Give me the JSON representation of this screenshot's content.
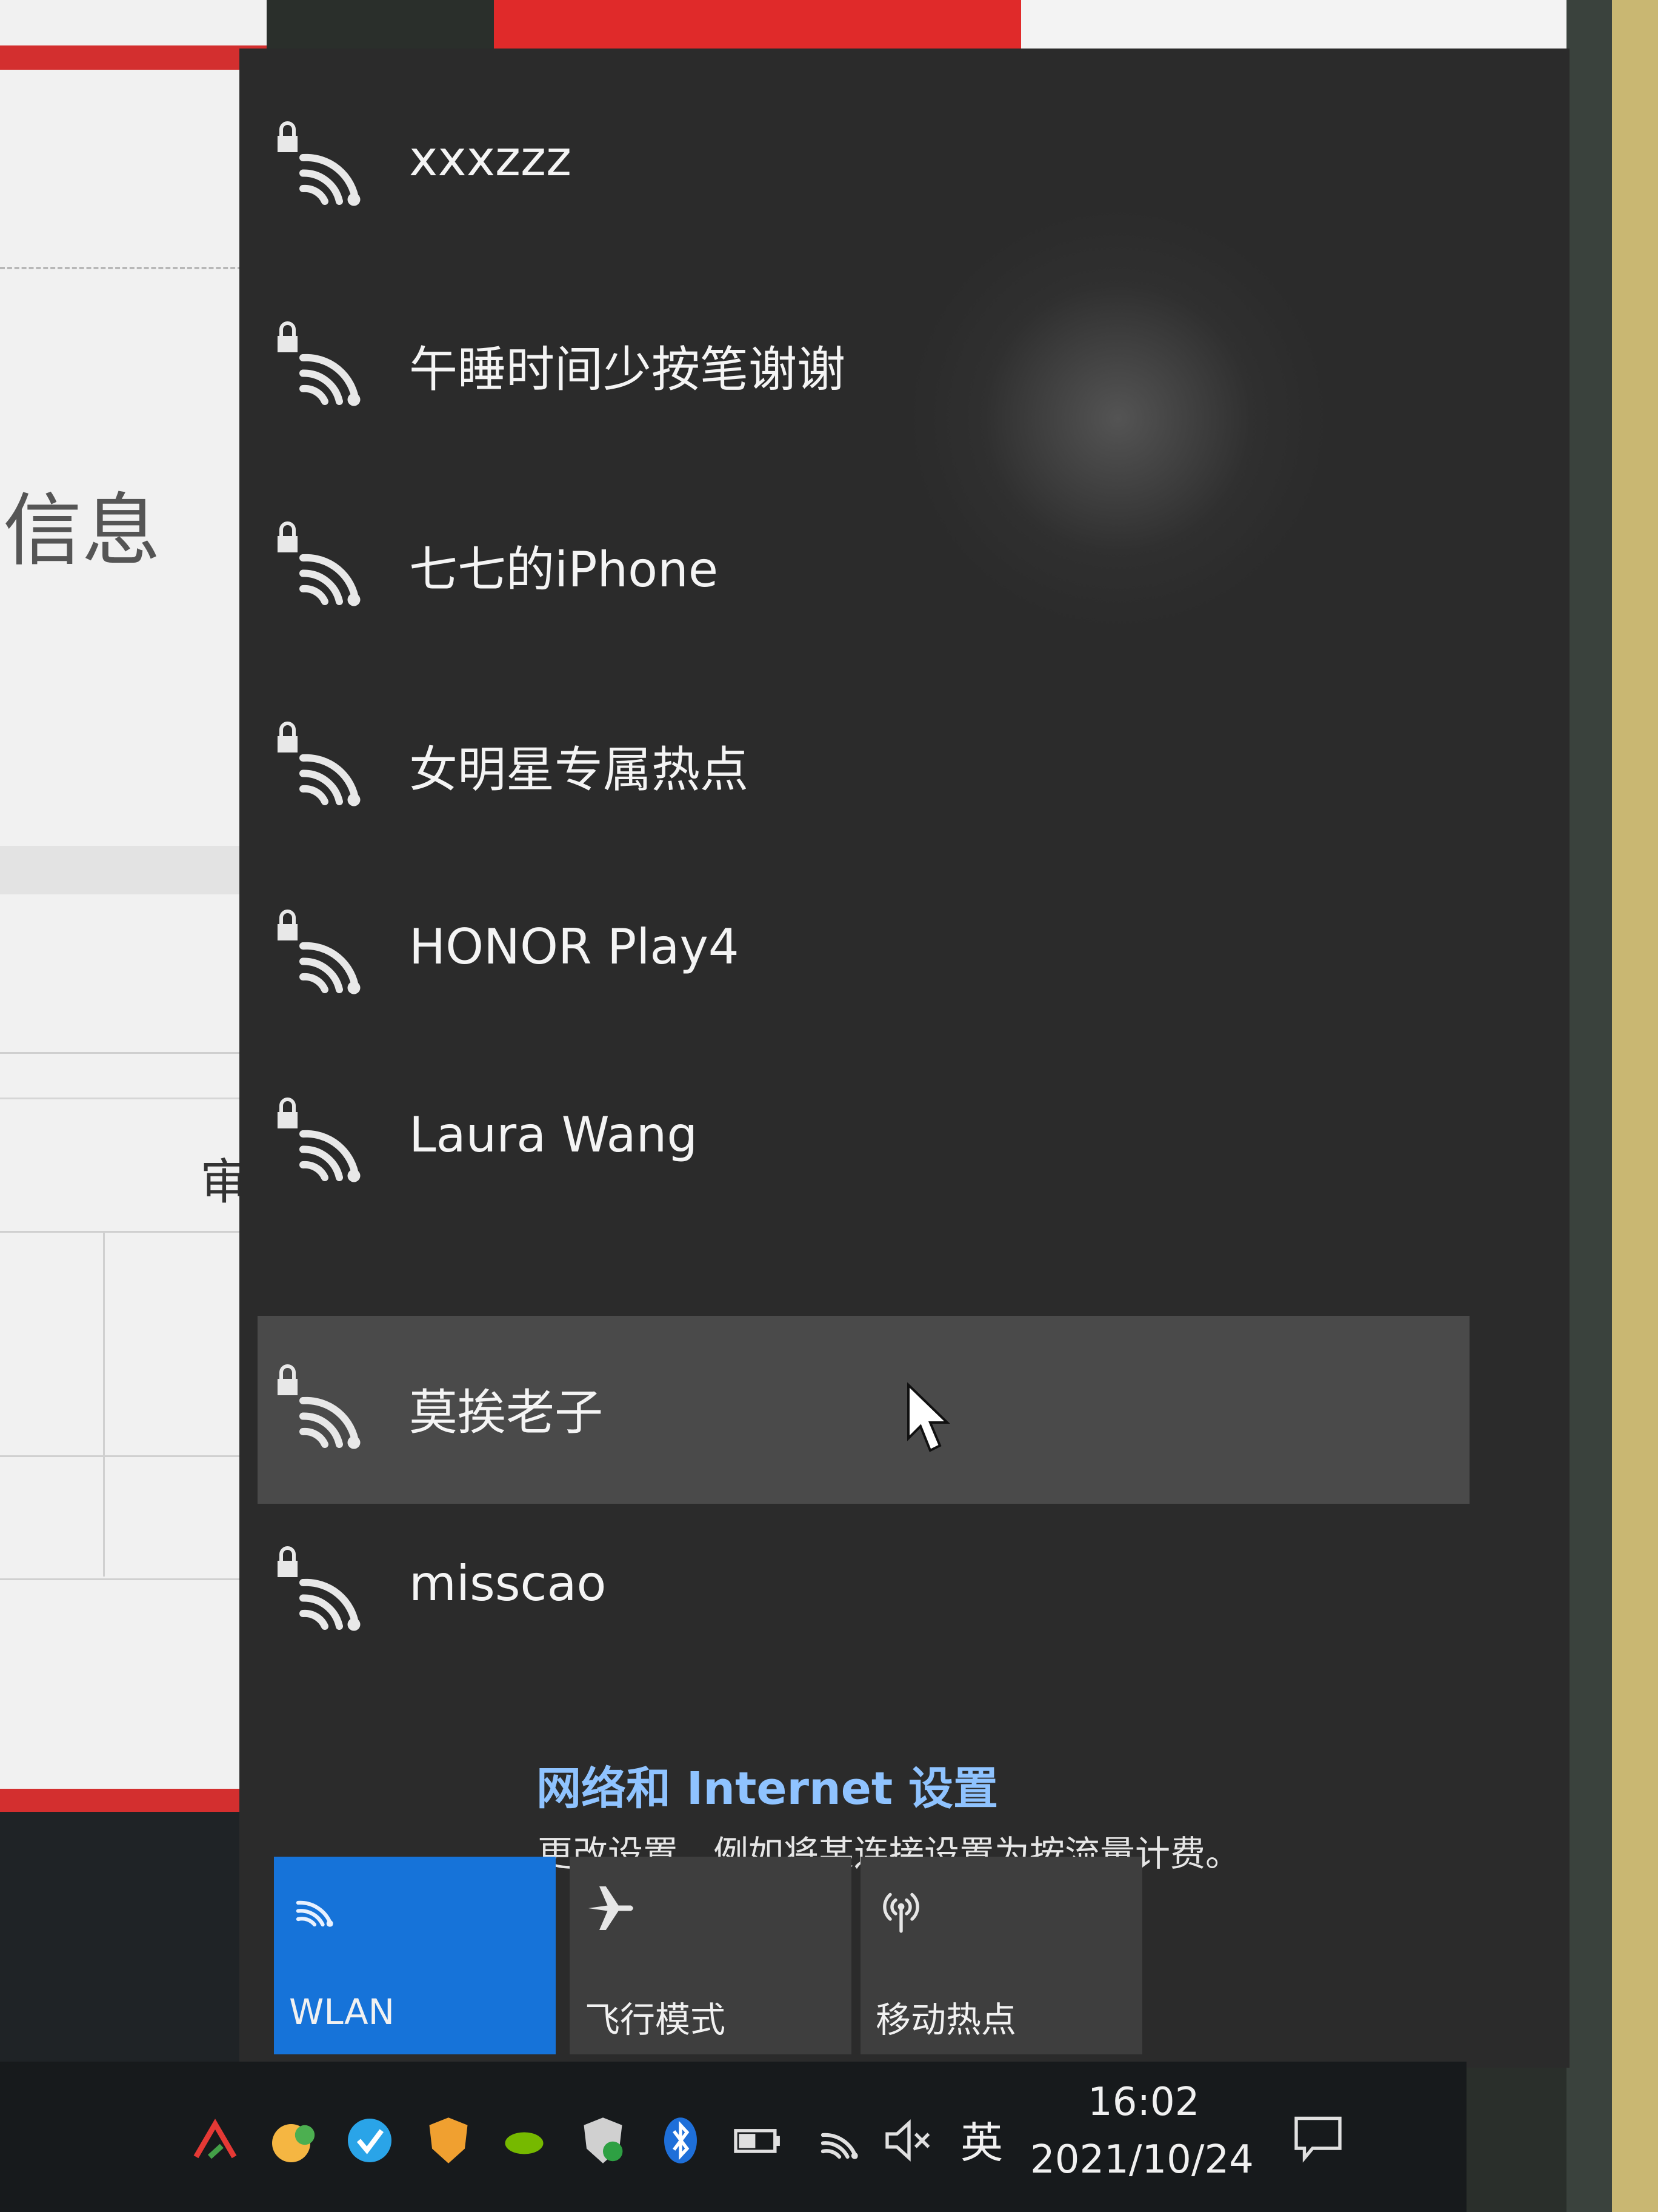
{
  "background_app": {
    "info_text": "信息",
    "side_label": "审"
  },
  "network_flyout": {
    "networks": [
      {
        "ssid": "xxxzzz",
        "secured": true
      },
      {
        "ssid": "午睡时间少按笔谢谢",
        "secured": true
      },
      {
        "ssid": "七七的iPhone",
        "secured": true
      },
      {
        "ssid": "女明星专属热点",
        "secured": true
      },
      {
        "ssid": "HONOR Play4",
        "secured": true
      },
      {
        "ssid": "Laura Wang",
        "secured": true
      },
      {
        "ssid": "莫挨老子",
        "secured": true,
        "highlighted": true
      },
      {
        "ssid": "misscao",
        "secured": true
      }
    ],
    "settings_link": "网络和 Internet 设置",
    "settings_description": "更改设置，例如将某连接设置为按流量计费。",
    "quick_actions": [
      {
        "label": "WLAN",
        "icon": "wifi-icon",
        "active": true
      },
      {
        "label": "飞行模式",
        "icon": "airplane-icon",
        "active": false
      },
      {
        "label": "移动热点",
        "icon": "hotspot-icon",
        "active": false
      }
    ]
  },
  "taskbar": {
    "ime_indicator": "英",
    "time": "16:02",
    "date": "2021/10/24",
    "tray_icons": [
      "show-hidden-icons",
      "app-tray-icon-1",
      "app-tray-icon-2",
      "security-shield-icon",
      "nvidia-icon",
      "windows-security-icon",
      "bluetooth-icon",
      "battery-icon",
      "wifi-icon",
      "volume-muted-icon"
    ]
  },
  "colors": {
    "flyout_bg": "#2b2b2b",
    "accent_blue": "#1673d9",
    "link_blue": "#8fc3ff",
    "hover_row": "#4a4a4a"
  }
}
